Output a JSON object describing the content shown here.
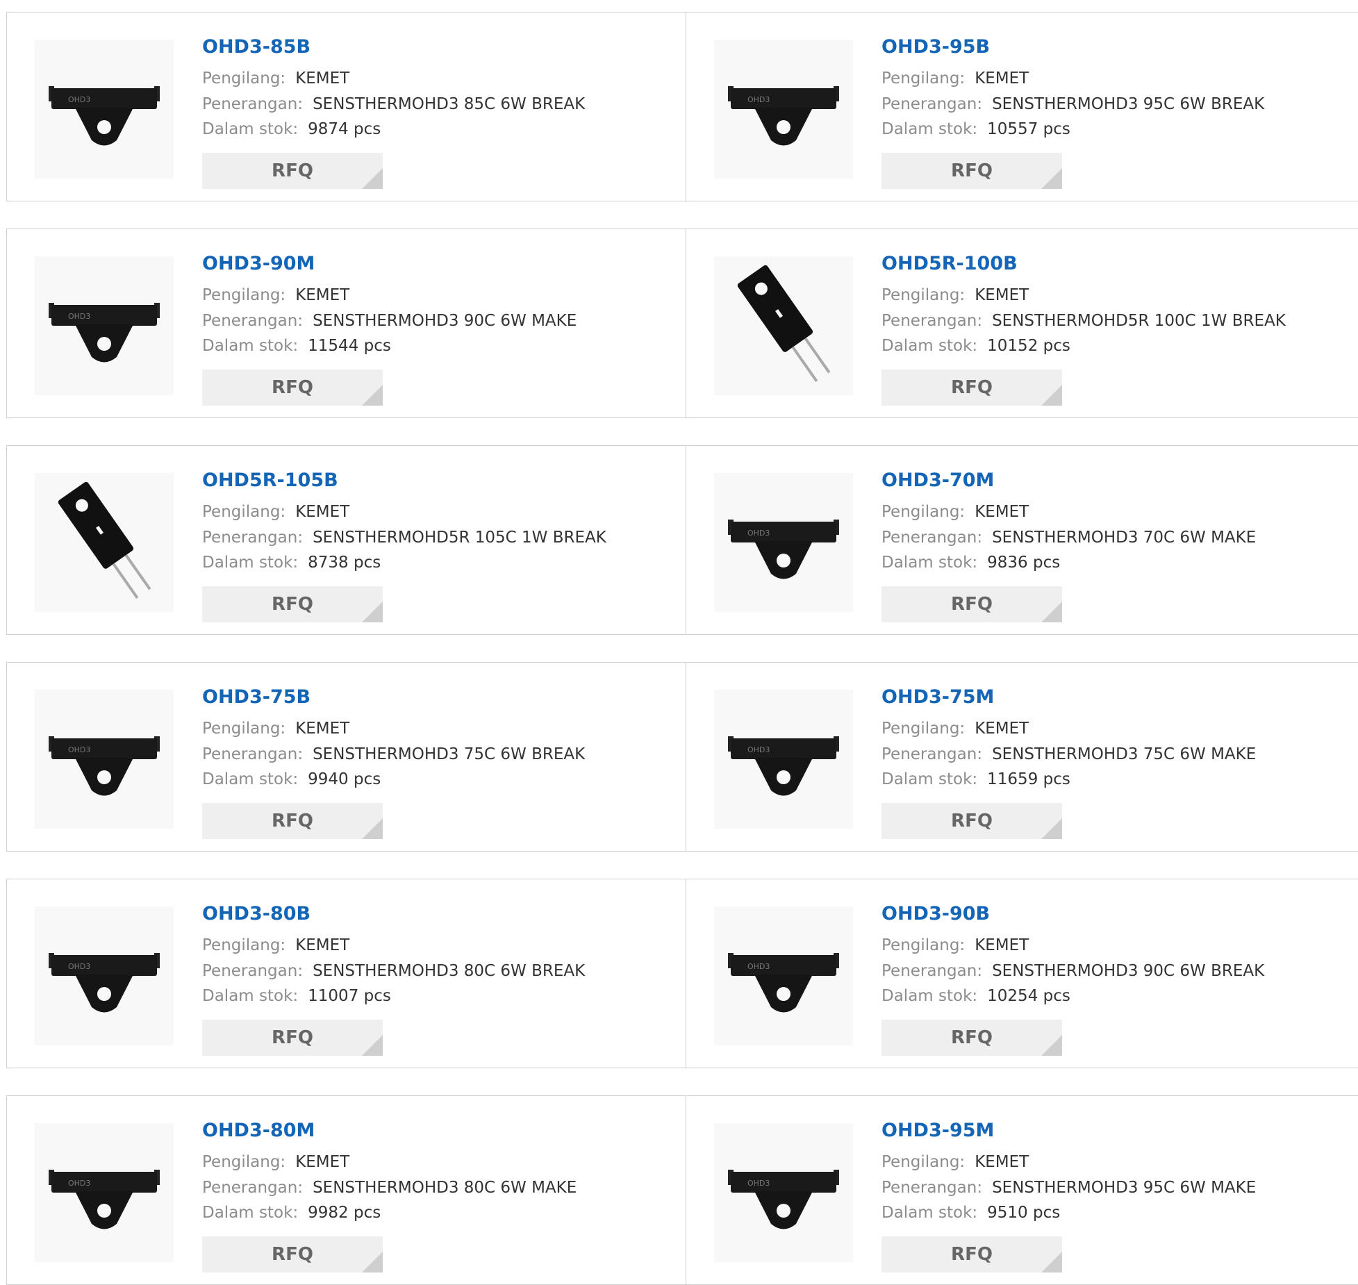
{
  "labels": {
    "manufacturer": "Pengilang:",
    "description": "Penerangan:",
    "stock": "Dalam stok:",
    "rfq": "RFQ"
  },
  "products": [
    {
      "part": "OHD3-85B",
      "manufacturer": "KEMET",
      "description": "SENSTHERMOHD3 85C 6W BREAK",
      "stock": "9874 pcs",
      "image_icon": "ohd3-thermostat-icon"
    },
    {
      "part": "OHD3-95B",
      "manufacturer": "KEMET",
      "description": "SENSTHERMOHD3 95C 6W BREAK",
      "stock": "10557 pcs",
      "image_icon": "ohd3-thermostat-icon"
    },
    {
      "part": "OHD3-90M",
      "manufacturer": "KEMET",
      "description": "SENSTHERMOHD3 90C 6W MAKE",
      "stock": "11544 pcs",
      "image_icon": "ohd3-thermostat-icon"
    },
    {
      "part": "OHD5R-100B",
      "manufacturer": "KEMET",
      "description": "SENSTHERMOHD5R 100C 1W BREAK",
      "stock": "10152 pcs",
      "image_icon": "ohd5r-thermostat-icon"
    },
    {
      "part": "OHD5R-105B",
      "manufacturer": "KEMET",
      "description": "SENSTHERMOHD5R 105C 1W BREAK",
      "stock": "8738 pcs",
      "image_icon": "ohd5r-thermostat-icon"
    },
    {
      "part": "OHD3-70M",
      "manufacturer": "KEMET",
      "description": "SENSTHERMOHD3 70C 6W MAKE",
      "stock": "9836 pcs",
      "image_icon": "ohd3-thermostat-icon"
    },
    {
      "part": "OHD3-75B",
      "manufacturer": "KEMET",
      "description": "SENSTHERMOHD3 75C 6W BREAK",
      "stock": "9940 pcs",
      "image_icon": "ohd3-thermostat-icon"
    },
    {
      "part": "OHD3-75M",
      "manufacturer": "KEMET",
      "description": "SENSTHERMOHD3 75C 6W MAKE",
      "stock": "11659 pcs",
      "image_icon": "ohd3-thermostat-icon"
    },
    {
      "part": "OHD3-80B",
      "manufacturer": "KEMET",
      "description": "SENSTHERMOHD3 80C 6W BREAK",
      "stock": "11007 pcs",
      "image_icon": "ohd3-thermostat-icon"
    },
    {
      "part": "OHD3-90B",
      "manufacturer": "KEMET",
      "description": "SENSTHERMOHD3 90C 6W BREAK",
      "stock": "10254 pcs",
      "image_icon": "ohd3-thermostat-icon"
    },
    {
      "part": "OHD3-80M",
      "manufacturer": "KEMET",
      "description": "SENSTHERMOHD3 80C 6W MAKE",
      "stock": "9982 pcs",
      "image_icon": "ohd3-thermostat-icon"
    },
    {
      "part": "OHD3-95M",
      "manufacturer": "KEMET",
      "description": "SENSTHERMOHD3 95C 6W MAKE",
      "stock": "9510 pcs",
      "image_icon": "ohd3-thermostat-icon"
    }
  ]
}
